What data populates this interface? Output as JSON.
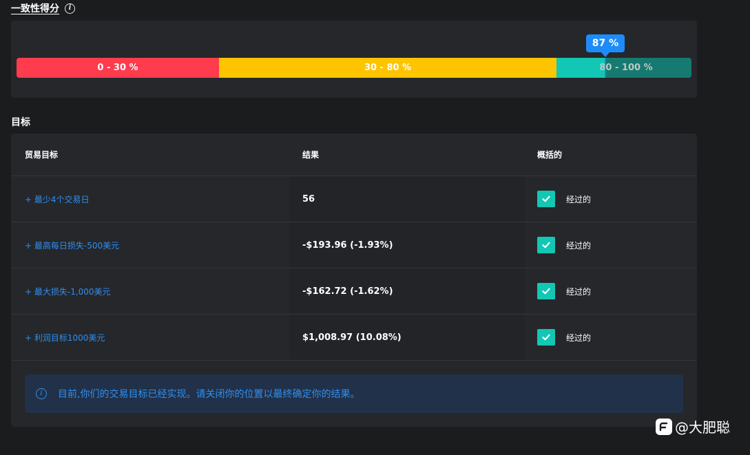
{
  "score": {
    "title": "一致性得分",
    "info_icon": "i",
    "value_label": "87 %",
    "value_percent": 87,
    "segments": [
      {
        "label": "0 - 30 %",
        "color": "#ff3b4e"
      },
      {
        "label": "30 - 80 %",
        "color": "#ffc400"
      },
      {
        "label": "80 - 100 %",
        "color": "#12c7b4"
      }
    ]
  },
  "objectives": {
    "title": "目标",
    "headers": {
      "goal": "贸易目标",
      "result": "结果",
      "summary": "概括的"
    },
    "rows": [
      {
        "goal": "+ 最少4个交易日",
        "result": "56",
        "status": "经过的"
      },
      {
        "goal": "+ 最高每日损失-500美元",
        "result": "-$193.96 (-1.93%)",
        "status": "经过的"
      },
      {
        "goal": "+ 最大损失-1,000美元",
        "result": "-$162.72 (-1.62%)",
        "status": "经过的"
      },
      {
        "goal": "+ 利润目标1000美元",
        "result": "$1,008.97 (10.08%)",
        "status": "经过的"
      }
    ],
    "notice": "目前,你们的交易目标已经实现。请关闭你的位置以最终确定你的结果。"
  },
  "watermark": {
    "text": "@大肥聪",
    "icon": "brand-logo-icon"
  },
  "colors": {
    "accent_blue": "#1d8cf8",
    "pass_green": "#12c7b4",
    "link_blue": "#2f8ff0"
  }
}
